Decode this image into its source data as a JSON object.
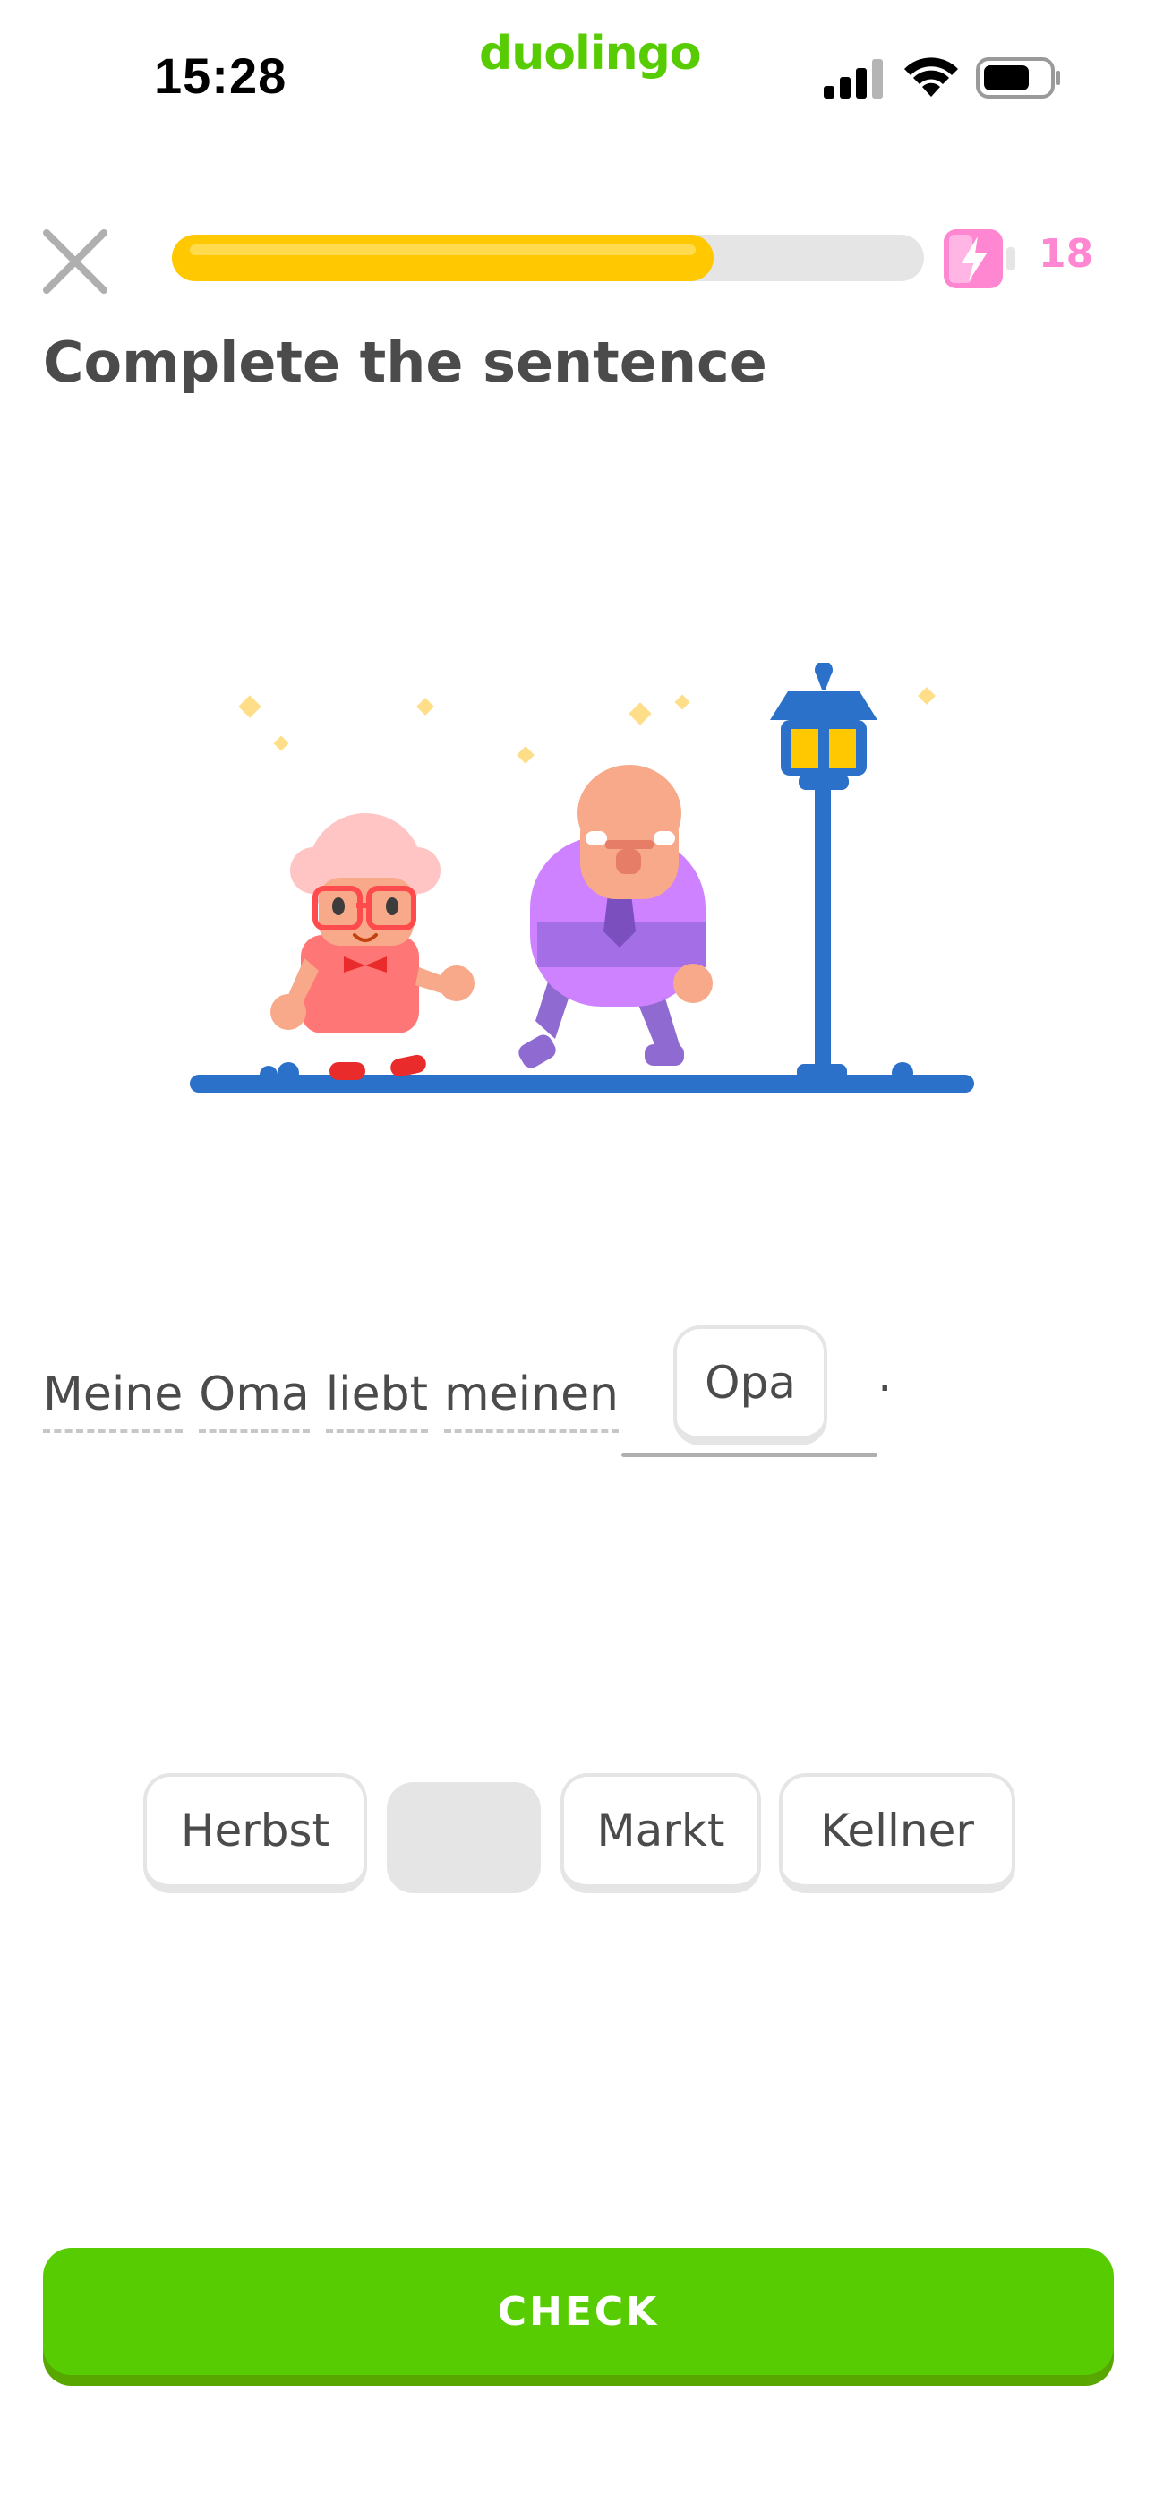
{
  "status_bar": {
    "time": "15:28",
    "brand": "duolingo"
  },
  "header": {
    "progress": 0.72,
    "energy_count": "18",
    "icons": {
      "close": "close-icon",
      "energy": "energy-battery-icon"
    }
  },
  "exercise": {
    "title": "Complete the sentence",
    "sentence_words": [
      "Meine",
      "Oma",
      "liebt",
      "meinen"
    ],
    "answer": "Opa",
    "terminal": "."
  },
  "word_bank": [
    "Herbst",
    "Opa",
    "Markt",
    "Kellner"
  ],
  "check_button": {
    "label": "CHECK"
  },
  "colors": {
    "brand_green": "#58cc02",
    "progress_yellow": "#ffc800",
    "energy_pink": "#ff86d0",
    "text": "#4b4b4b"
  }
}
